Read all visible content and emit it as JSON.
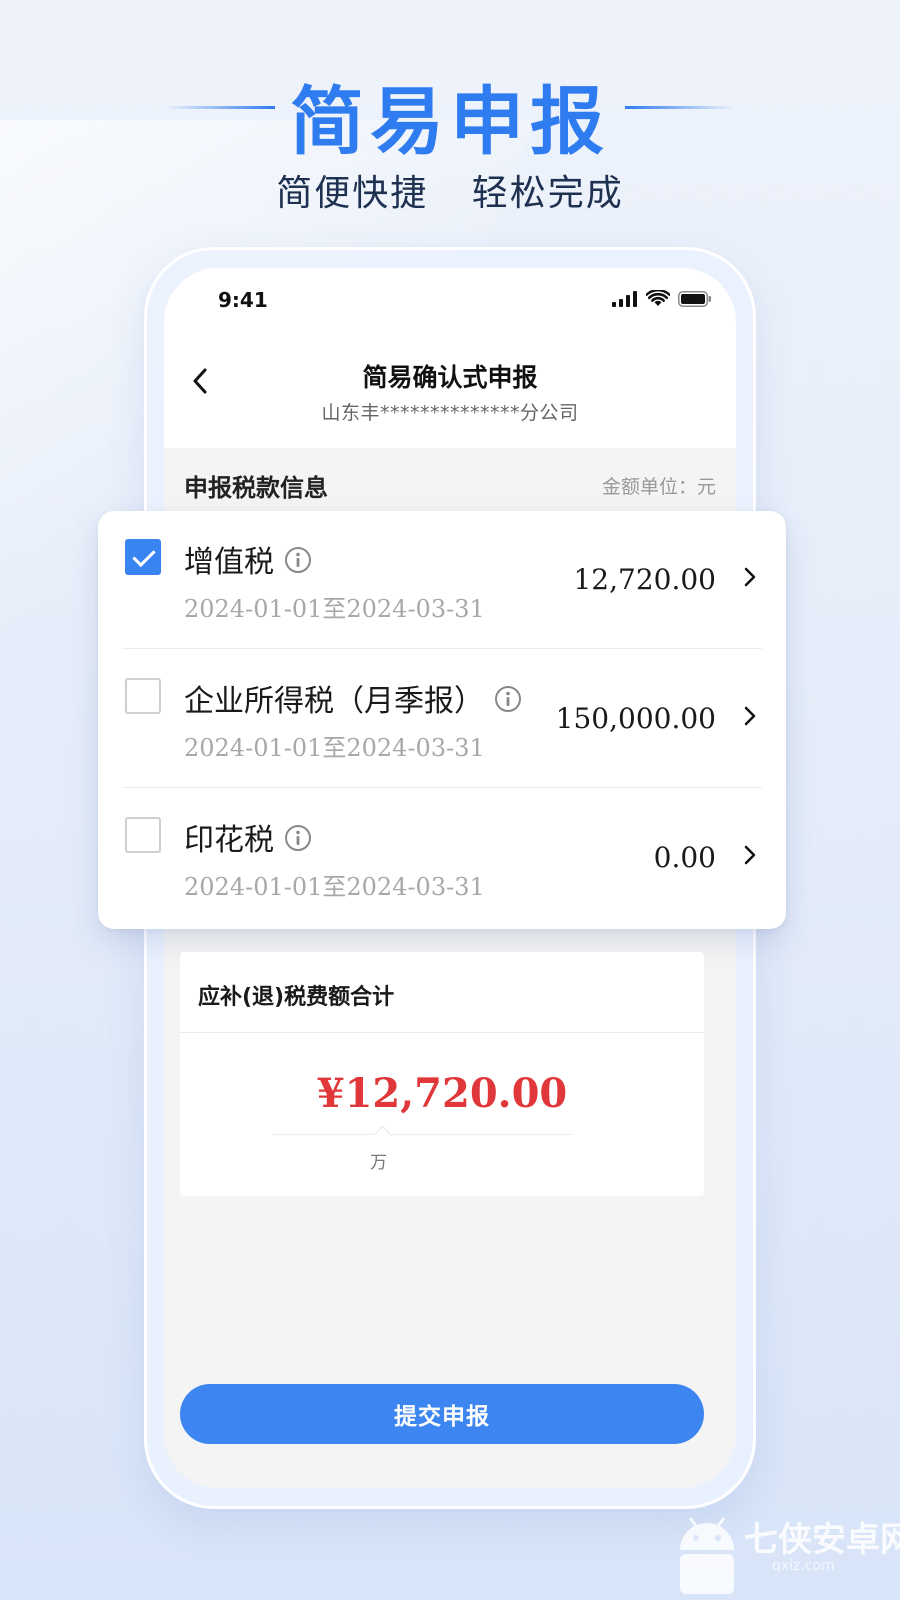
{
  "hero": {
    "title": "简易申报",
    "subtitle": "简便快捷 轻松完成"
  },
  "status_bar": {
    "time": "9:41"
  },
  "nav": {
    "title": "简易确认式申报",
    "subtitle": "山东丰**************分公司"
  },
  "section": {
    "title": "申报税款信息",
    "unit": "金额单位：元"
  },
  "tax_items": [
    {
      "name": "增值税",
      "period": "2024-01-01至2024-03-31",
      "amount": "12,720.00",
      "checked": true
    },
    {
      "name": "企业所得税（月季报）",
      "period": "2024-01-01至2024-03-31",
      "amount": "150,000.00",
      "checked": false
    },
    {
      "name": "印花税",
      "period": "2024-01-01至2024-03-31",
      "amount": "0.00",
      "checked": false
    }
  ],
  "total": {
    "title": "应补(退)税费额合计",
    "amount": "¥12,720.00",
    "unit_hint": "万"
  },
  "submit_label": "提交申报",
  "watermark": {
    "text": "七侠安卓网",
    "url": "qxiz.com"
  },
  "colors": {
    "accent": "#3d86f1",
    "amount_red": "#e0383a"
  }
}
